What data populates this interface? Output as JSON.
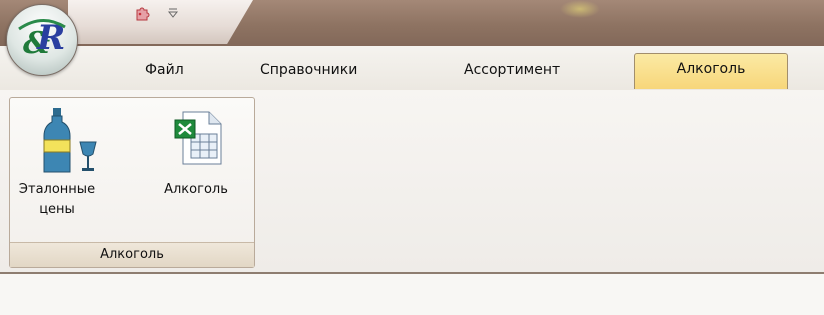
{
  "tabs": [
    {
      "label": "Файл",
      "active": false
    },
    {
      "label": "Справочники",
      "active": false
    },
    {
      "label": "Ассортимент",
      "active": false
    },
    {
      "label": "Алкоголь",
      "active": true
    }
  ],
  "ribbon": {
    "group_label": "Алкоголь",
    "buttons": [
      {
        "label": "Эталонные\nцены",
        "icon": "bottle-glass-icon"
      },
      {
        "label": "Алкоголь",
        "icon": "excel-icon"
      }
    ]
  },
  "qat": {
    "icons": [
      "puzzle-icon",
      "dropdown-arrow-icon"
    ]
  },
  "colors": {
    "titlebar": "#9a7f6e",
    "active_tab": "#f9dd87",
    "ribbon_bg": "#f7f5f2"
  }
}
